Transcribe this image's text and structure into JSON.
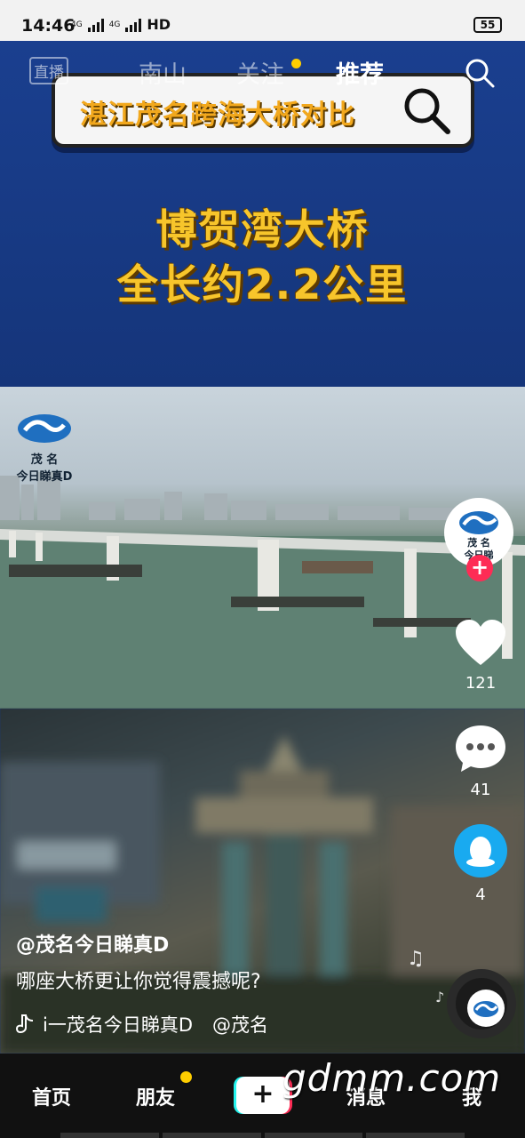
{
  "status_bar": {
    "time": "14:46",
    "net1": "4G",
    "net2": "4G",
    "hd": "HD",
    "battery": "55"
  },
  "top_nav": {
    "live_label": "直播",
    "tabs": [
      {
        "label": "南山",
        "active": false
      },
      {
        "label": "关注",
        "active": false,
        "badge": true
      },
      {
        "label": "推荐",
        "active": true
      }
    ],
    "search_icon": "search-icon"
  },
  "video": {
    "search_banner_text": "湛江茂名跨海大桥对比",
    "headline_line1": "博贺湾大桥",
    "headline_line2": "全长约2.2公里",
    "watermark_logo_line1": "茂  名",
    "watermark_logo_line2": "今日睇真D"
  },
  "rail": {
    "avatar_text1": "茂  名",
    "avatar_text2": "今日睇",
    "likes": "121",
    "comments": "41",
    "shares": "4",
    "like_icon": "heart-icon",
    "comment_icon": "comment-bubble-icon",
    "share_icon": "qq-penguin-icon"
  },
  "caption": {
    "user": "@茂名今日睇真D",
    "text": "哪座大桥更让你觉得震撼呢?",
    "music_text": "i一茂名今日睇真D",
    "mention": "@茂名"
  },
  "bottom_nav": {
    "items": [
      "首页",
      "朋友",
      "消息",
      "我"
    ],
    "create_symbol": "+",
    "friends_badge": true
  },
  "overlay_watermark": "gdmm.com",
  "colors": {
    "accent_red": "#fe2c55",
    "accent_cyan": "#25f4ee",
    "headline_yellow": "#f7c52b",
    "badge_yellow": "#ffce00"
  }
}
